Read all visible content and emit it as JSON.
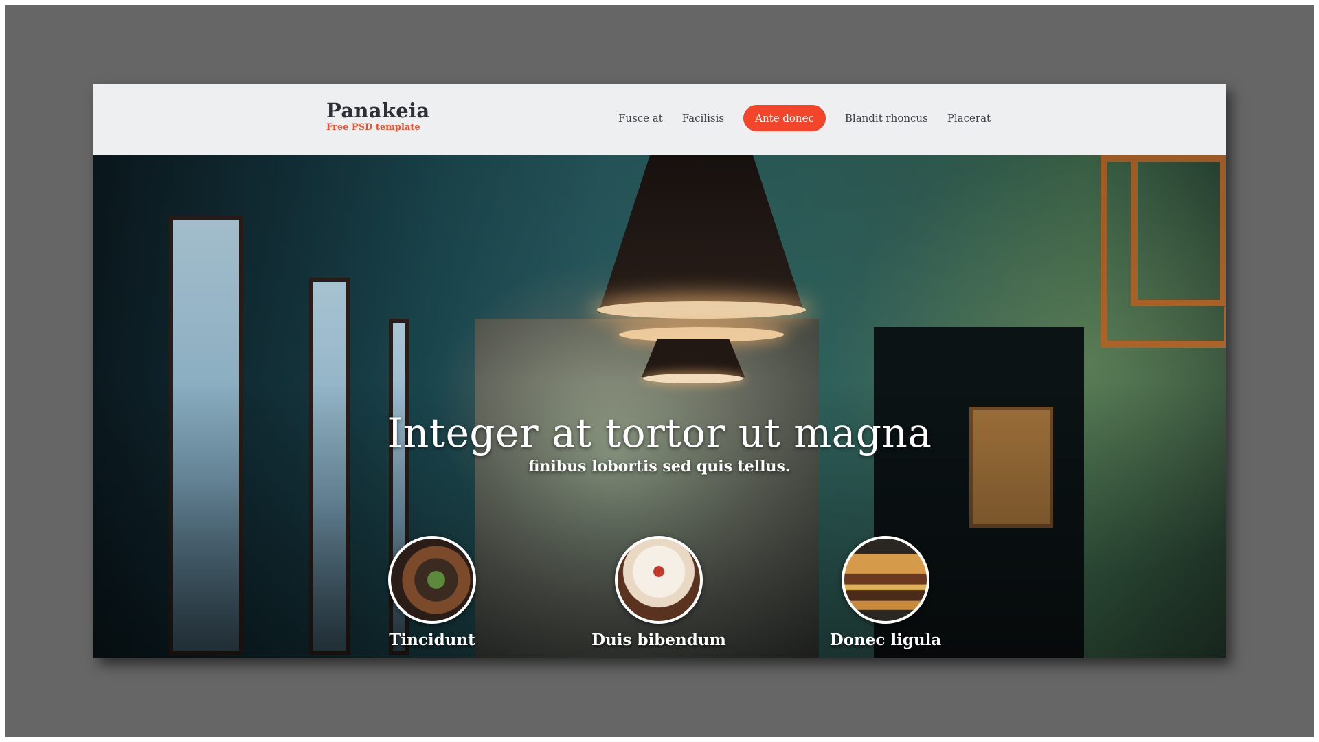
{
  "brand": {
    "name": "Panakeia",
    "tagline": "Free PSD template"
  },
  "nav": {
    "items": [
      {
        "label": "Fusce at",
        "active": false
      },
      {
        "label": "Facilisis",
        "active": false
      },
      {
        "label": "Ante donec",
        "active": true
      },
      {
        "label": "Blandit rhoncus",
        "active": false
      },
      {
        "label": "Placerat",
        "active": false
      }
    ]
  },
  "hero": {
    "title": "Integer at tortor ut magna",
    "subtitle": "finibus lobortis sed quis tellus."
  },
  "features": [
    {
      "label": "Tincidunt",
      "icon": "burger-photo"
    },
    {
      "label": "Duis bibendum",
      "icon": "cupcake-photo"
    },
    {
      "label": "Donec ligula",
      "icon": "hamburger-photo"
    }
  ],
  "colors": {
    "accent": "#f2452a",
    "brand_tagline": "#f1502f",
    "header_bg": "#eeeff0",
    "backdrop": "#666666"
  }
}
